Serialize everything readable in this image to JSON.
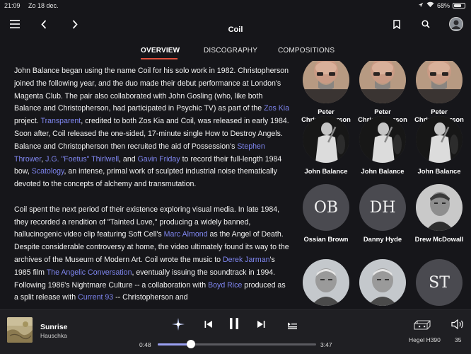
{
  "status_bar": {
    "time": "21:09",
    "date": "Zo 18 dec.",
    "battery": "68%",
    "battery_level": 0.68
  },
  "nav": {
    "title": "Coil"
  },
  "tabs": [
    {
      "label": "OVERVIEW",
      "active": true
    },
    {
      "label": "DISCOGRAPHY",
      "active": false
    },
    {
      "label": "COMPOSITIONS",
      "active": false
    }
  ],
  "bio": {
    "p1": [
      {
        "t": "John Balance began using the name Coil for his solo work in 1982. Christopherson joined the following year, and the duo made their debut performance at London's Magenta Club. The pair also collaborated with John Gosling (who, like both Balance and Christopherson, had participated in Psychic TV) as part of the "
      },
      {
        "t": "Zos Kia",
        "link": true
      },
      {
        "t": " project. "
      },
      {
        "t": "Transparent",
        "link": true
      },
      {
        "t": ", credited to both Zos Kia and Coil, was released in early 1984. Soon after, Coil released the one-sided, 17-minute single How to Destroy Angels. Balance and Christopherson then recruited the aid of Possession's "
      },
      {
        "t": "Stephen Thrower",
        "link": true
      },
      {
        "t": ", "
      },
      {
        "t": "J.G. \"Foetus\" Thirlwell",
        "link": true
      },
      {
        "t": ", and "
      },
      {
        "t": "Gavin Friday",
        "link": true
      },
      {
        "t": " to record their full-length 1984 bow, "
      },
      {
        "t": "Scatology",
        "link": true
      },
      {
        "t": ", an intense, primal work of sculpted industrial noise thematically devoted to the concepts of alchemy and transmutation."
      }
    ],
    "p2": [
      {
        "t": "Coil spent the next period of their existence exploring visual media. In late 1984, they recorded a rendition of \"Tainted Love,\" producing a widely banned, hallucinogenic video clip featuring Soft Cell's "
      },
      {
        "t": "Marc Almond",
        "link": true
      },
      {
        "t": " as the Angel of Death. Despite considerable controversy at home, the video ultimately found its way to the archives of the Museum of Modern Art. Coil wrote the music to "
      },
      {
        "t": "Derek Jarman",
        "link": true
      },
      {
        "t": "'s 1985 film "
      },
      {
        "t": "The Angelic Conversation",
        "link": true
      },
      {
        "t": ", eventually issuing the soundtrack in 1994. Following 1986's Nightmare Culture -- a collaboration with "
      },
      {
        "t": "Boyd Rice",
        "link": true
      },
      {
        "t": " produced as a split release with "
      },
      {
        "t": "Current 93",
        "link": true
      },
      {
        "t": " -- Christopherson and"
      }
    ]
  },
  "members": [
    {
      "name": "Peter Christopherson",
      "photo": "bald-man"
    },
    {
      "name": "Peter Christopherson",
      "photo": "bald-man"
    },
    {
      "name": "Peter Christopherson",
      "photo": "bald-man"
    },
    {
      "name": "John Balance",
      "photo": "singer"
    },
    {
      "name": "John Balance",
      "photo": "singer"
    },
    {
      "name": "John Balance",
      "photo": "singer"
    },
    {
      "name": "Ossian Brown",
      "initials": "OB"
    },
    {
      "name": "Danny Hyde",
      "initials": "DH"
    },
    {
      "name": "Drew McDowall",
      "photo": "man-bw"
    },
    {
      "name": "",
      "photo": "older-man"
    },
    {
      "name": "",
      "photo": "older-man"
    },
    {
      "name": "",
      "initials": "ST"
    }
  ],
  "player": {
    "track_title": "Sunrise",
    "artist": "Hauschka",
    "elapsed": "0:48",
    "total": "3:47",
    "progress_fraction": 0.211,
    "device": "Hegel H390",
    "volume": "35"
  },
  "colors": {
    "accent": "#e0513d",
    "link": "#7f86f0",
    "progress": "#9aa0f2",
    "background": "#16161a"
  }
}
